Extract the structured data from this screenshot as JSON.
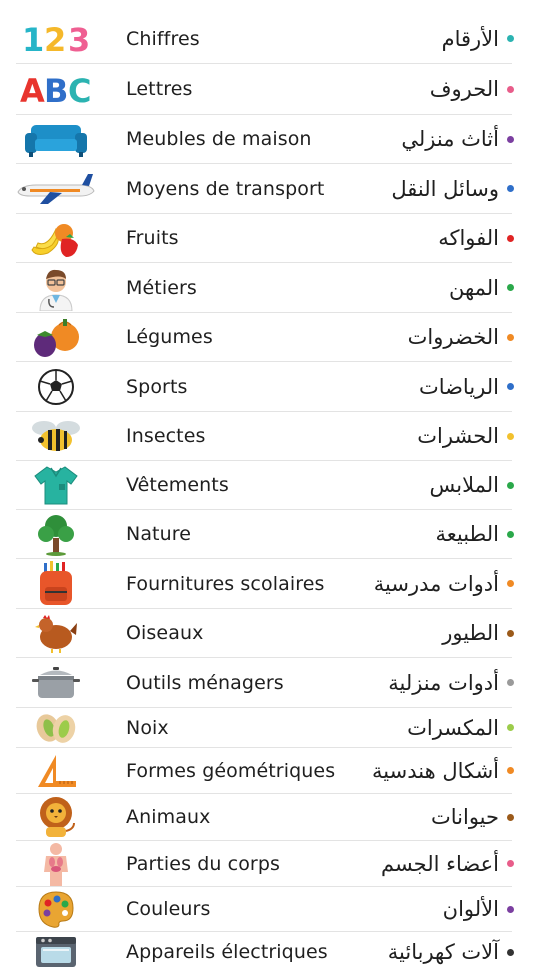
{
  "categories": [
    {
      "fr": "Chiffres",
      "ar": "الأرقام",
      "icon": "numbers-123-icon",
      "dot": "#2bb3b1"
    },
    {
      "fr": "Lettres",
      "ar": "الحروف",
      "icon": "letters-abc-icon",
      "dot": "#e85d8a"
    },
    {
      "fr": "Meubles de maison",
      "ar": "أثاث منزلي",
      "icon": "sofa-icon",
      "dot": "#7b3fa0"
    },
    {
      "fr": "Moyens de transport",
      "ar": "وسائل النقل",
      "icon": "airplane-icon",
      "dot": "#2f6fc9"
    },
    {
      "fr": "Fruits",
      "ar": "الفواكه",
      "icon": "fruits-icon",
      "dot": "#e02424"
    },
    {
      "fr": "Métiers",
      "ar": "المهن",
      "icon": "doctor-icon",
      "dot": "#2aa84a"
    },
    {
      "fr": "Légumes",
      "ar": "الخضروات",
      "icon": "vegetables-icon",
      "dot": "#f08a24"
    },
    {
      "fr": "Sports",
      "ar": "الرياضات",
      "icon": "soccer-ball-icon",
      "dot": "#2f6fc9"
    },
    {
      "fr": "Insectes",
      "ar": "الحشرات",
      "icon": "bee-icon",
      "dot": "#f2c12e"
    },
    {
      "fr": "Vêtements",
      "ar": "الملابس",
      "icon": "shirt-icon",
      "dot": "#2aa84a"
    },
    {
      "fr": "Nature",
      "ar": "الطبيعة",
      "icon": "tree-icon",
      "dot": "#2aa84a"
    },
    {
      "fr": "Fournitures scolaires",
      "ar": "أدوات مدرسية",
      "icon": "school-bag-icon",
      "dot": "#f08a24"
    },
    {
      "fr": "Oiseaux",
      "ar": "الطيور",
      "icon": "hen-icon",
      "dot": "#9b5a1a"
    },
    {
      "fr": "Outils ménagers",
      "ar": "أدوات منزلية",
      "icon": "cooking-pot-icon",
      "dot": "#9a9a9a"
    },
    {
      "fr": "Noix",
      "ar": "المكسرات",
      "icon": "pistachio-icon",
      "dot": "#9ccc4a"
    },
    {
      "fr": "Formes géométriques",
      "ar": "أشكال هندسية",
      "icon": "set-square-icon",
      "dot": "#f08a24"
    },
    {
      "fr": "Animaux",
      "ar": "حيوانات",
      "icon": "lion-icon",
      "dot": "#9b5a1a"
    },
    {
      "fr": "Parties du corps",
      "ar": "أعضاء الجسم",
      "icon": "human-body-icon",
      "dot": "#e85d8a"
    },
    {
      "fr": "Couleurs",
      "ar": "الألوان",
      "icon": "paint-palette-icon",
      "dot": "#7b3fa0"
    },
    {
      "fr": "Appareils électriques",
      "ar": "آلات كهربائية",
      "icon": "oven-icon",
      "dot": "#333333"
    }
  ]
}
